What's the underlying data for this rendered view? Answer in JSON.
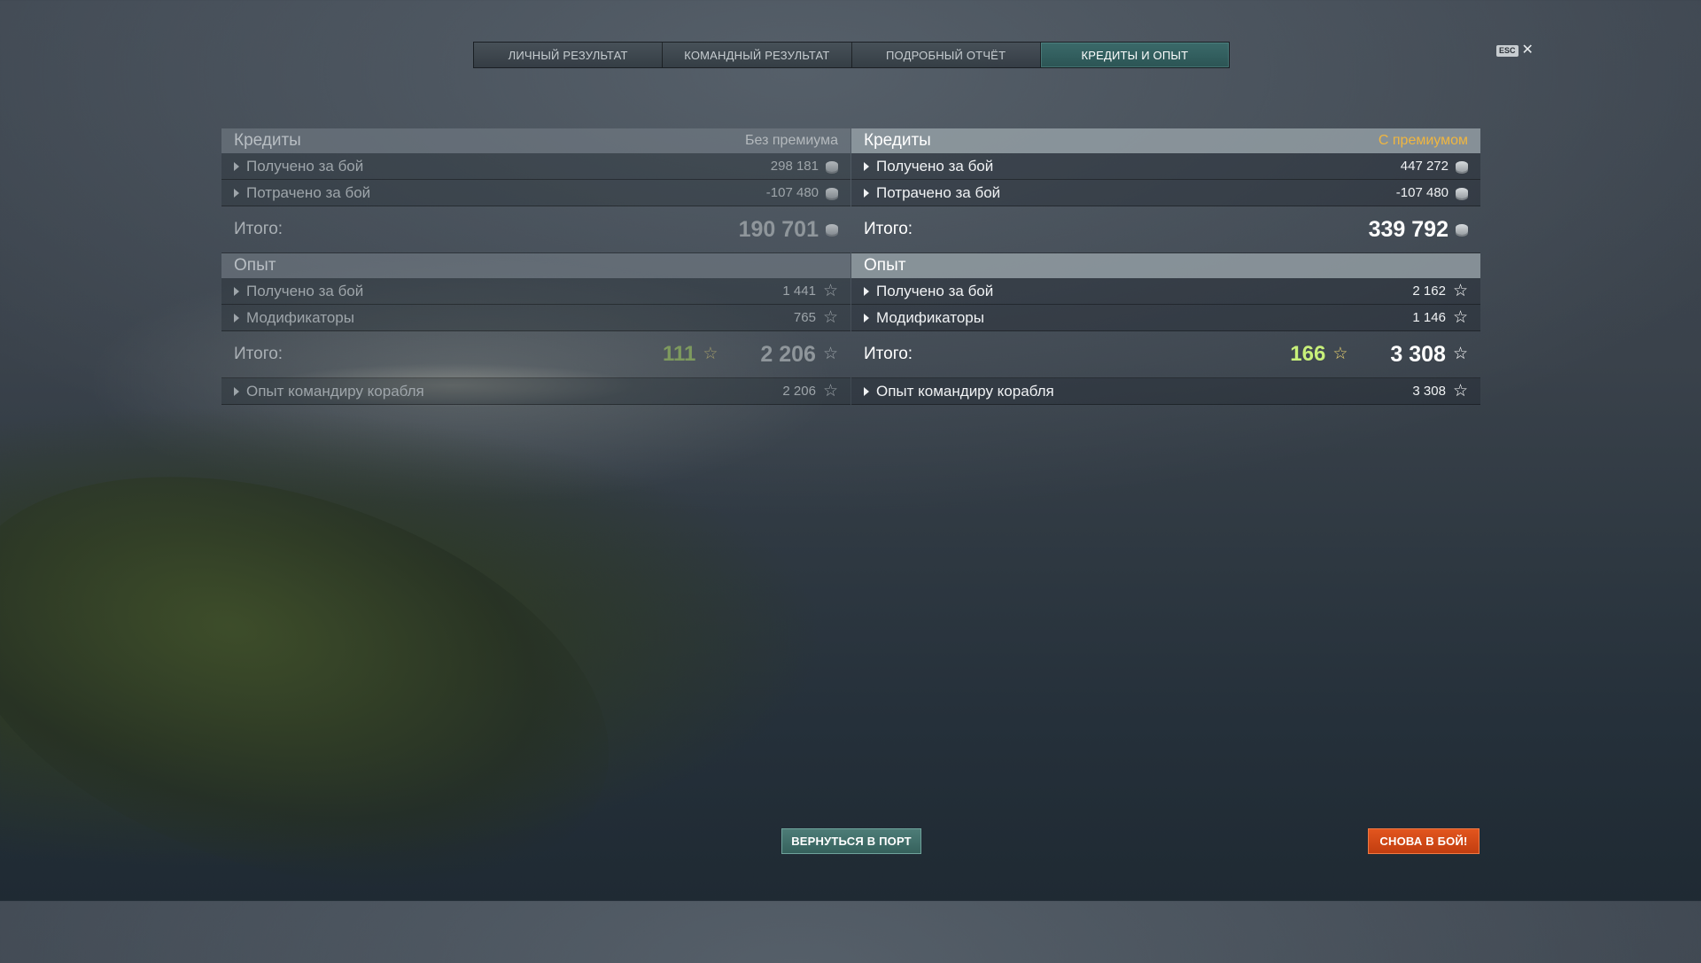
{
  "tabs": [
    {
      "label": "ЛИЧНЫЙ РЕЗУЛЬТАТ",
      "active": false
    },
    {
      "label": "КОМАНДНЫЙ РЕЗУЛЬТАТ",
      "active": false
    },
    {
      "label": "ПОДРОБНЫЙ ОТЧЁТ",
      "active": false
    },
    {
      "label": "КРЕДИТЫ И ОПЫТ",
      "active": true
    }
  ],
  "close": {
    "esc_label": "ESC",
    "icon": "close-icon"
  },
  "colors": {
    "active_tab": "#2b5454",
    "premium_accent": "#f0b640",
    "bonus_green": "#c8f07a",
    "battle_button": "#c23e10"
  },
  "left": {
    "credits": {
      "title": "Кредиты",
      "mode_label": "Без премиума",
      "rows": [
        {
          "label": "Получено за бой",
          "value": "298 181"
        },
        {
          "label": "Потрачено за бой",
          "value": "-107 480"
        }
      ],
      "total_label": "Итого:",
      "total_value": "190 701"
    },
    "exp": {
      "title": "Опыт",
      "rows": [
        {
          "label": "Получено за бой",
          "value": "1 441"
        },
        {
          "label": "Модификаторы",
          "value": "765"
        }
      ],
      "total_label": "Итого:",
      "bonus_value": "111",
      "total_value": "2 206",
      "commander_label": "Опыт командиру корабля",
      "commander_value": "2 206"
    }
  },
  "right": {
    "credits": {
      "title": "Кредиты",
      "mode_label": "С премиумом",
      "rows": [
        {
          "label": "Получено за бой",
          "value": "447 272"
        },
        {
          "label": "Потрачено за бой",
          "value": "-107 480"
        }
      ],
      "total_label": "Итого:",
      "total_value": "339 792"
    },
    "exp": {
      "title": "Опыт",
      "rows": [
        {
          "label": "Получено за бой",
          "value": "2 162"
        },
        {
          "label": "Модификаторы",
          "value": "1 146"
        }
      ],
      "total_label": "Итого:",
      "bonus_value": "166",
      "total_value": "3 308",
      "commander_label": "Опыт командиру корабля",
      "commander_value": "3 308"
    }
  },
  "buttons": {
    "return_port": "ВЕРНУТЬСЯ В ПОРТ",
    "battle_again": "СНОВА В БОЙ!"
  }
}
